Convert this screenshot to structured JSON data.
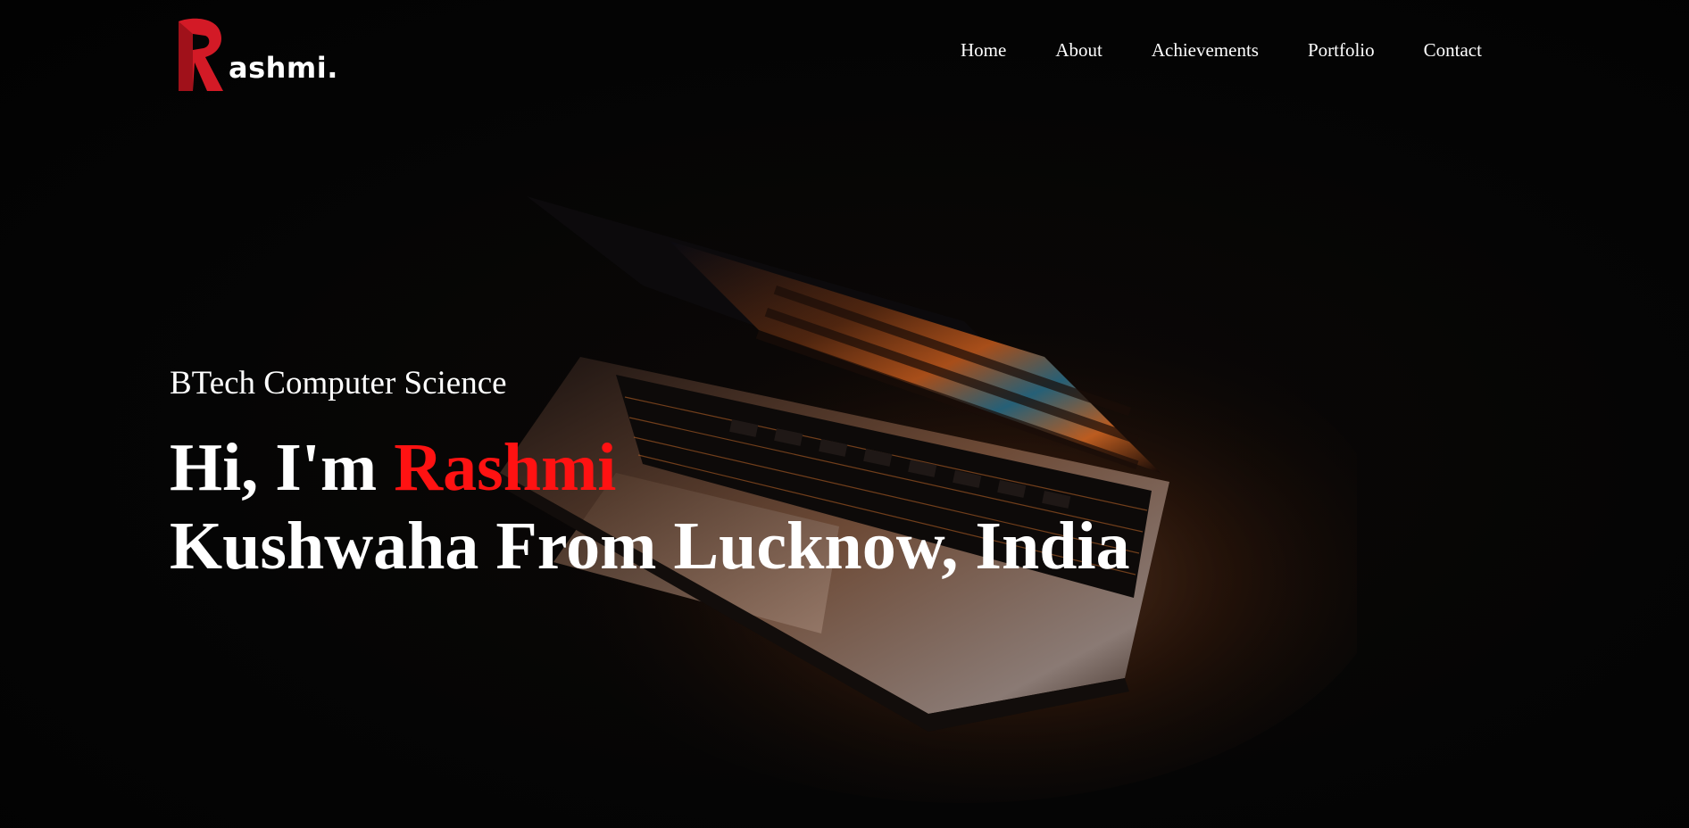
{
  "brand": {
    "logo_letter": "R",
    "logo_text": "ashmi.",
    "accent_color": "#d31a26"
  },
  "nav": {
    "items": [
      {
        "label": "Home"
      },
      {
        "label": "About"
      },
      {
        "label": "Achievements"
      },
      {
        "label": "Portfolio"
      },
      {
        "label": "Contact"
      }
    ]
  },
  "hero": {
    "subtitle": "BTech Computer Science",
    "greeting": "Hi, I'm",
    "name_highlight": "Rashmi",
    "title_rest": "Kushwaha From Lucknow, India",
    "highlight_color": "#ff1212",
    "background_image": "laptop-keyboard-glow"
  }
}
